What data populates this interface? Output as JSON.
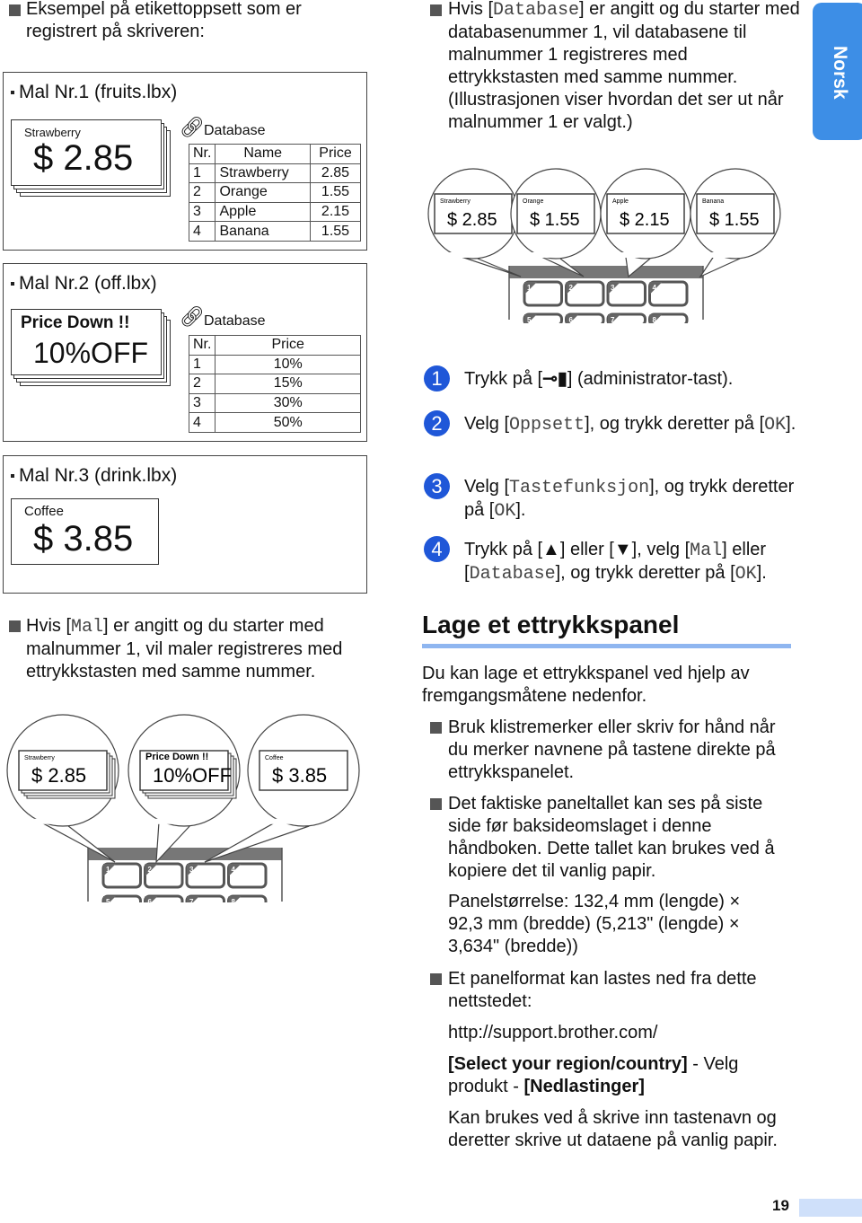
{
  "intro": "Eksempel på etikettoppsett som er registrert på skriveren:",
  "templates": [
    {
      "label": "Mal  Nr.1  (fruits.lbx)",
      "small": "Strawberry",
      "big": "$  2.85",
      "db_label": "Database",
      "headers": [
        "Nr.",
        "Name",
        "Price"
      ],
      "rows": [
        [
          "1",
          "Strawberry",
          "2.85"
        ],
        [
          "2",
          "Orange",
          "1.55"
        ],
        [
          "3",
          "Apple",
          "2.15"
        ],
        [
          "4",
          "Banana",
          "1.55"
        ]
      ]
    },
    {
      "label": "Mal  Nr.2  (off.lbx)",
      "small": "Price Down !!",
      "big": "10%OFF",
      "db_label": "Database",
      "headers": [
        "Nr.",
        "Price"
      ],
      "rows": [
        [
          "1",
          "10%"
        ],
        [
          "2",
          "15%"
        ],
        [
          "3",
          "30%"
        ],
        [
          "4",
          "50%"
        ]
      ]
    },
    {
      "label": "Mal  Nr.3  (drink.lbx)",
      "small": "Coffee",
      "big": "$  3.85"
    }
  ],
  "db_para": {
    "pre": "Hvis [",
    "code": "Database",
    "post": "] er angitt og du starter med databasenummer 1, vil databasene til malnummer 1 registreres med ettrykkstasten med samme nummer. (Illustrasjonen viser hvordan det ser ut når malnummer 1 er valgt.)"
  },
  "db_bubbles": [
    {
      "small": "Strawberry",
      "big": "$  2.85"
    },
    {
      "small": "Orange",
      "big": "$  1.55"
    },
    {
      "small": "Apple",
      "big": "$  2.15"
    },
    {
      "small": "Banana",
      "big": "$  1.55"
    }
  ],
  "keys": [
    "1",
    "2",
    "3",
    "4",
    "5",
    "6",
    "7",
    "8"
  ],
  "side_tab": "Norsk",
  "steps": [
    {
      "n": "1",
      "parts": [
        [
          "t",
          "Trykk på ["
        ],
        [
          "icon",
          "key-icon"
        ],
        [
          "t",
          "] (administrator-tast)."
        ]
      ]
    },
    {
      "n": "2",
      "parts": [
        [
          "t",
          "Velg ["
        ],
        [
          "c",
          "Oppsett"
        ],
        [
          "t",
          "], og trykk deretter på ["
        ],
        [
          "c",
          "OK"
        ],
        [
          "t",
          "]."
        ]
      ]
    },
    {
      "n": "3",
      "parts": [
        [
          "t",
          "Velg ["
        ],
        [
          "c",
          "Tastefunksjon"
        ],
        [
          "t",
          "], og trykk deretter på ["
        ],
        [
          "c",
          "OK"
        ],
        [
          "t",
          "]."
        ]
      ]
    },
    {
      "n": "4",
      "parts": [
        [
          "t",
          "Trykk på [▲] eller [▼], velg ["
        ],
        [
          "c",
          "Mal"
        ],
        [
          "t",
          "] eller ["
        ],
        [
          "c",
          "Database"
        ],
        [
          "t",
          "], og trykk deretter på ["
        ],
        [
          "c",
          "OK"
        ],
        [
          "t",
          "]."
        ]
      ]
    }
  ],
  "mal_para": {
    "pre": "Hvis [",
    "code": "Mal",
    "post": "] er angitt og du starter med malnummer 1, vil maler registreres med ettrykkstasten med samme nummer."
  },
  "mal_bubbles": [
    {
      "small": "Strawberry",
      "big": "$  2.85"
    },
    {
      "small": "Price Down !!",
      "big": "10%OFF"
    },
    {
      "small": "Coffee",
      "big": "$  3.85"
    }
  ],
  "section": {
    "heading": "Lage et ettrykkspanel",
    "intro": "Du kan lage et ettrykkspanel ved hjelp av fremgangsmåtene nedenfor.",
    "bullet1": "Bruk klistremerker eller skriv for hånd når du merker navnene på tastene direkte på ettrykkspanelet.",
    "bullet2": "Det faktiske paneltallet kan ses på siste side før baksideomslaget i denne håndboken. Dette tallet kan brukes ved å kopiere det til vanlig papir.",
    "size": "Panelstørrelse: 132,4 mm (lengde) × 92,3 mm (bredde) (5,213\" (lengde) × 3,634\" (bredde))",
    "bullet3": "Et panelformat kan lastes ned fra dette nettstedet:",
    "url": "http://support.brother.com/",
    "path_b1": "[Select your region/country]",
    "path_t1": " - Velg produkt - ",
    "path_b2": "[Nedlastinger]",
    "last": "Kan brukes ved å skrive inn tastenavn og deretter skrive ut dataene på vanlig papir."
  },
  "page_number": "19",
  "colors": {
    "accent": "#1f57d8",
    "tab": "#3d8ee6",
    "underline": "#8fb6f0"
  }
}
